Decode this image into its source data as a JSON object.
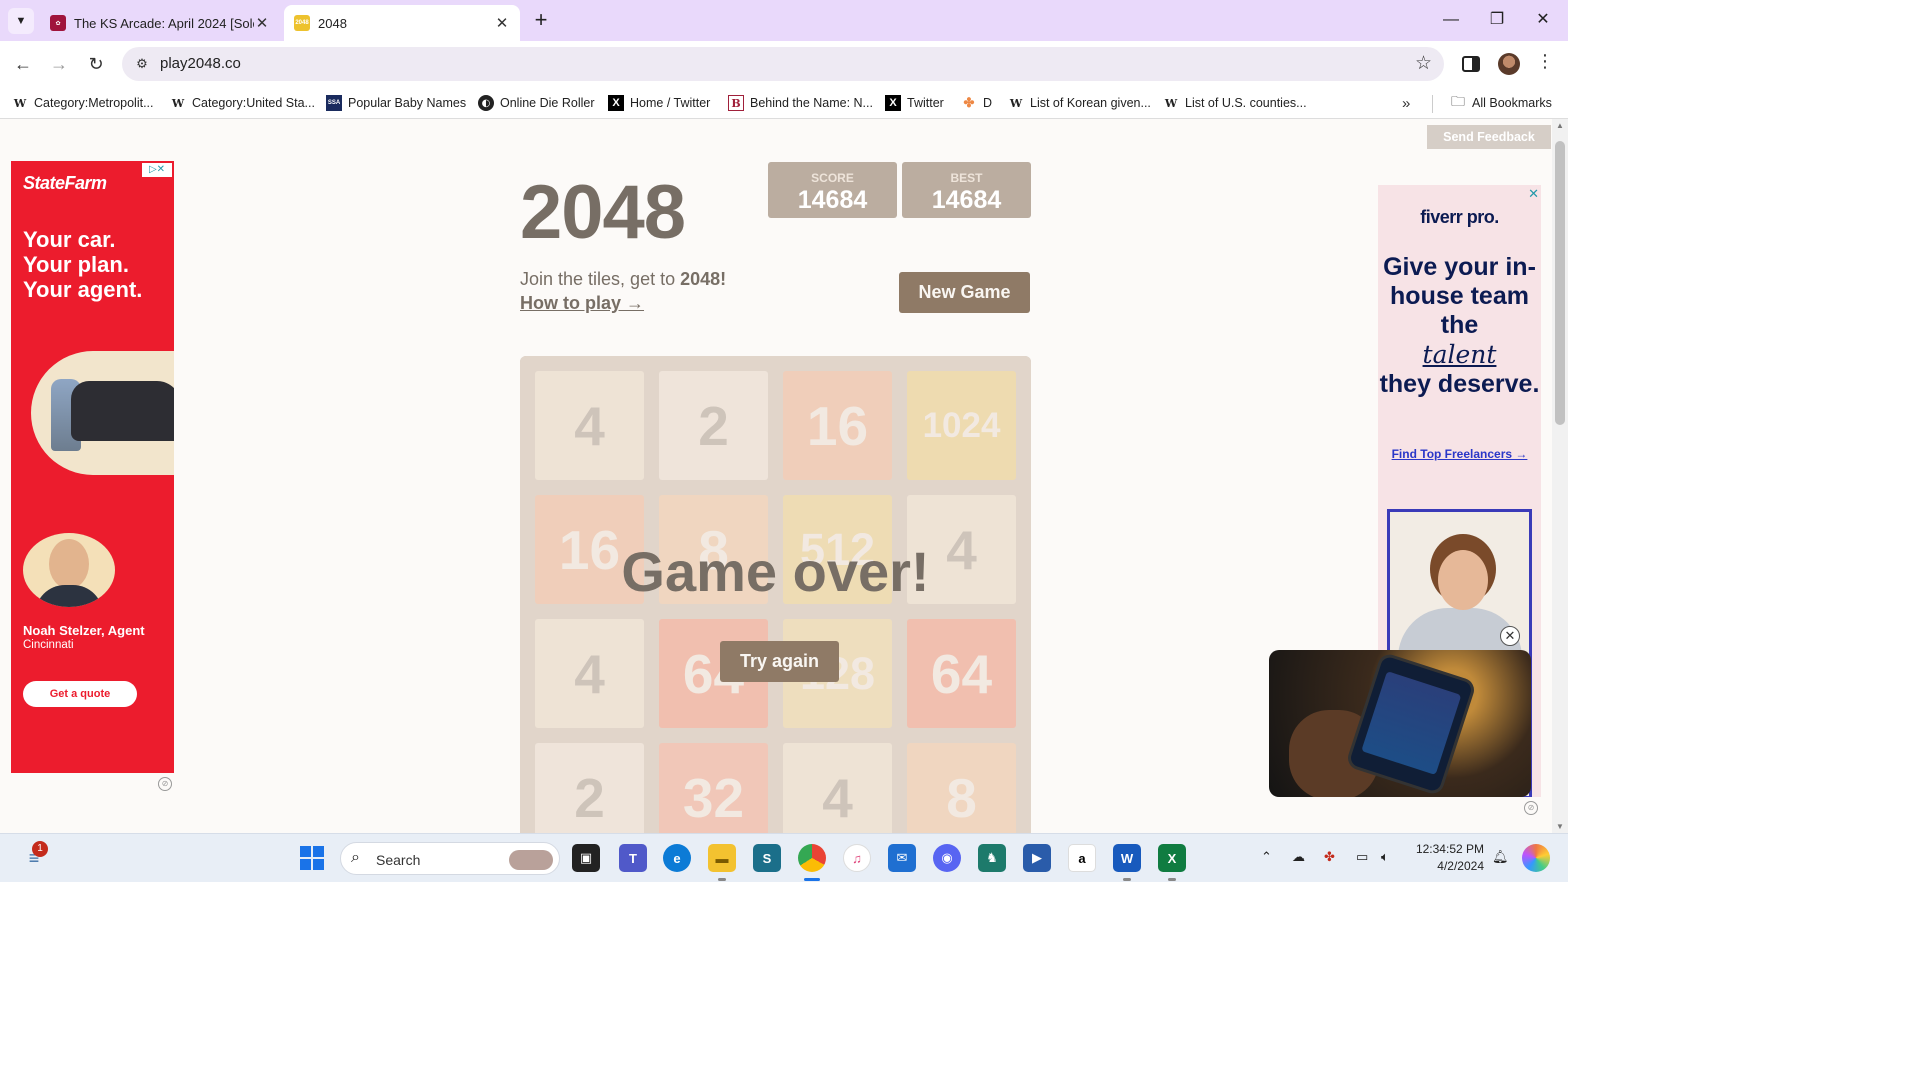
{
  "browser": {
    "tabs": [
      {
        "title": "The KS Arcade: April 2024 [Solo",
        "active": false
      },
      {
        "title": "2048",
        "favicon_text": "2048",
        "active": true
      }
    ],
    "url": "play2048.co",
    "bookmarks": [
      {
        "label": "Category:Metropolit...",
        "icon": "W"
      },
      {
        "label": "Category:United Sta...",
        "icon": "W"
      },
      {
        "label": "Popular Baby Names",
        "icon": "SSA"
      },
      {
        "label": "Online Die Roller",
        "icon": "globe"
      },
      {
        "label": "Home / Twitter",
        "icon": "X"
      },
      {
        "label": "Behind the Name: N...",
        "icon": "B"
      },
      {
        "label": "Twitter",
        "icon": "X"
      },
      {
        "label": "D",
        "icon": "pinwheel"
      },
      {
        "label": "List of Korean given...",
        "icon": "W"
      },
      {
        "label": "List of U.S. counties...",
        "icon": "W"
      }
    ],
    "all_bookmarks_label": "All Bookmarks"
  },
  "page": {
    "send_feedback": "Send Feedback",
    "game": {
      "title": "2048",
      "score_label": "SCORE",
      "score": "14684",
      "best_label": "BEST",
      "best": "14684",
      "intro_text": "Join the tiles, get to ",
      "intro_bold": "2048!",
      "how_to_play": "How to play →",
      "new_game": "New Game",
      "game_over": "Game over!",
      "try_again": "Try again",
      "grid": [
        [
          "4",
          "2",
          "16",
          "1024"
        ],
        [
          "16",
          "8",
          "512",
          "4"
        ],
        [
          "4",
          "64",
          "128",
          "64"
        ],
        [
          "2",
          "32",
          "4",
          "8"
        ]
      ]
    },
    "ad_left": {
      "brand": "StateFarm",
      "headline": [
        "Your car.",
        "Your plan.",
        "Your agent."
      ],
      "agent_name": "Noah Stelzer, Agent",
      "agent_city": "Cincinnati",
      "cta": "Get a quote"
    },
    "ad_right": {
      "brand": "fiverr pro.",
      "headline_1": "Give your in-house team the",
      "headline_em": "talent",
      "headline_2": "they deserve.",
      "cta": "Find Top Freelancers →"
    }
  },
  "taskbar": {
    "search_label": "Search",
    "notification_count": "1",
    "time": "12:34:52 PM",
    "date": "4/2/2024"
  }
}
